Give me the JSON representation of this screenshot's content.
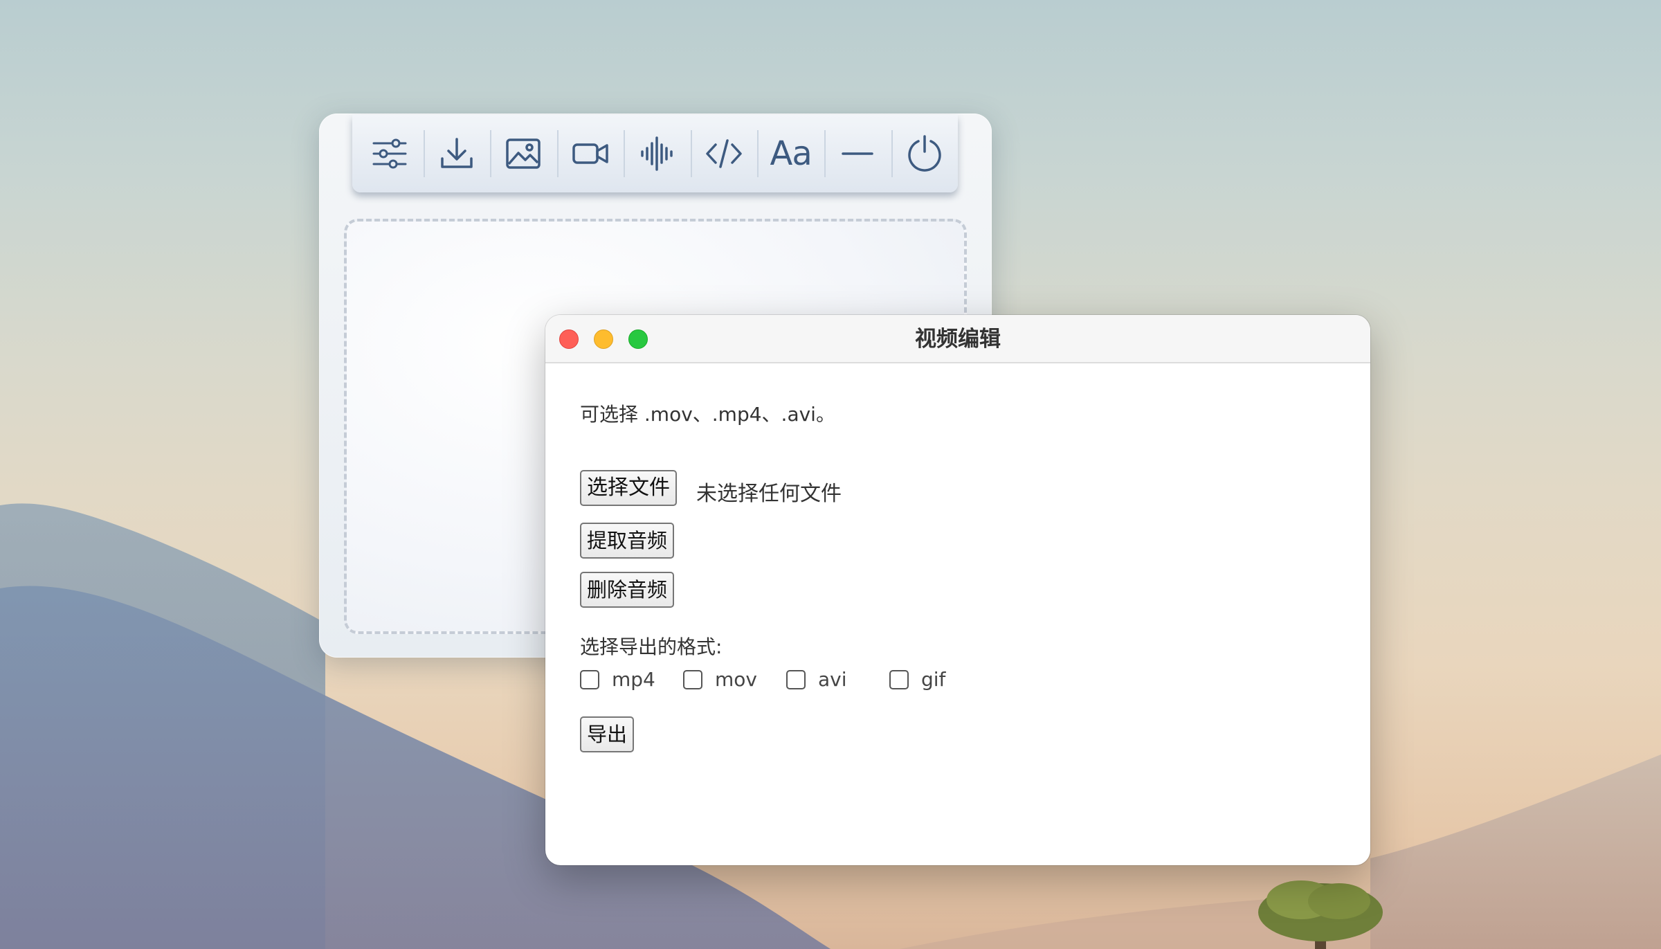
{
  "desktop": {
    "colors": {
      "sky_top": "#b9cdd0",
      "sky_bottom": "#d9b69a",
      "mountains": "#6e88a6"
    }
  },
  "toolbar": {
    "items": [
      {
        "icon": "sliders-icon",
        "name": "settings"
      },
      {
        "icon": "download-icon",
        "name": "download"
      },
      {
        "icon": "image-icon",
        "name": "image"
      },
      {
        "icon": "video-camera-icon",
        "name": "video"
      },
      {
        "icon": "audio-waveform-icon",
        "name": "audio"
      },
      {
        "icon": "code-icon",
        "name": "code"
      },
      {
        "icon": "text-font-icon",
        "name": "text",
        "label": "Aa"
      },
      {
        "icon": "minimize-icon",
        "name": "minimize"
      },
      {
        "icon": "power-icon",
        "name": "power"
      }
    ],
    "icon_color": "#3d5a80"
  },
  "window": {
    "title": "视频编辑",
    "hint": "可选择 .mov、.mp4、.avi。",
    "file_button": "选择文件",
    "file_status": "未选择任何文件",
    "extract_button": "提取音频",
    "delete_button": "删除音频",
    "format_label": "选择导出的格式:",
    "formats": [
      {
        "label": "mp4",
        "checked": false
      },
      {
        "label": "mov",
        "checked": false
      },
      {
        "label": "avi",
        "checked": false
      },
      {
        "label": "gif",
        "checked": false
      }
    ],
    "export_button": "导出"
  }
}
